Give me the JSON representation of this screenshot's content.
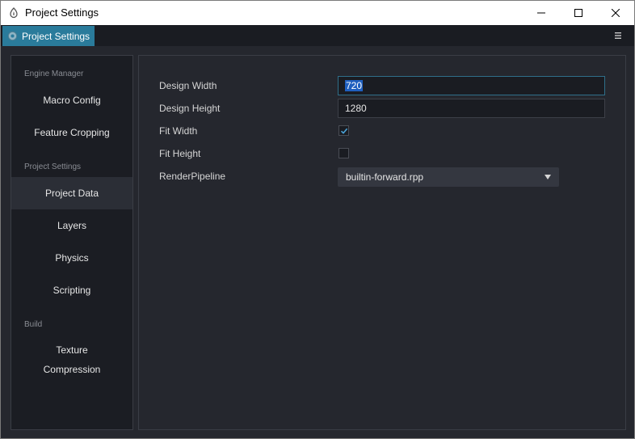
{
  "window": {
    "title": "Project Settings",
    "icon": "cocos-app-icon"
  },
  "tabs": [
    {
      "label": "Project Settings",
      "icon": "gear-icon",
      "active": true
    }
  ],
  "sidebar": {
    "sections": [
      {
        "header": "Engine Manager",
        "items": [
          "Macro Config",
          "Feature Cropping"
        ]
      },
      {
        "header": "Project Settings",
        "items": [
          "Project Data",
          "Layers",
          "Physics",
          "Scripting"
        ]
      },
      {
        "header": "Build",
        "items": [
          "Texture Compression"
        ]
      }
    ],
    "active_item": "Project Data"
  },
  "form": {
    "design_width": {
      "label": "Design Width",
      "value": "720"
    },
    "design_height": {
      "label": "Design Height",
      "value": "1280"
    },
    "fit_width": {
      "label": "Fit Width",
      "checked": true
    },
    "fit_height": {
      "label": "Fit Height",
      "checked": false
    },
    "render_pipeline": {
      "label": "RenderPipeline",
      "value": "builtin-forward.rpp"
    }
  },
  "colors": {
    "accent": "#2a7b9b",
    "background": "#25272e",
    "sidebar": "#1b1d23"
  }
}
